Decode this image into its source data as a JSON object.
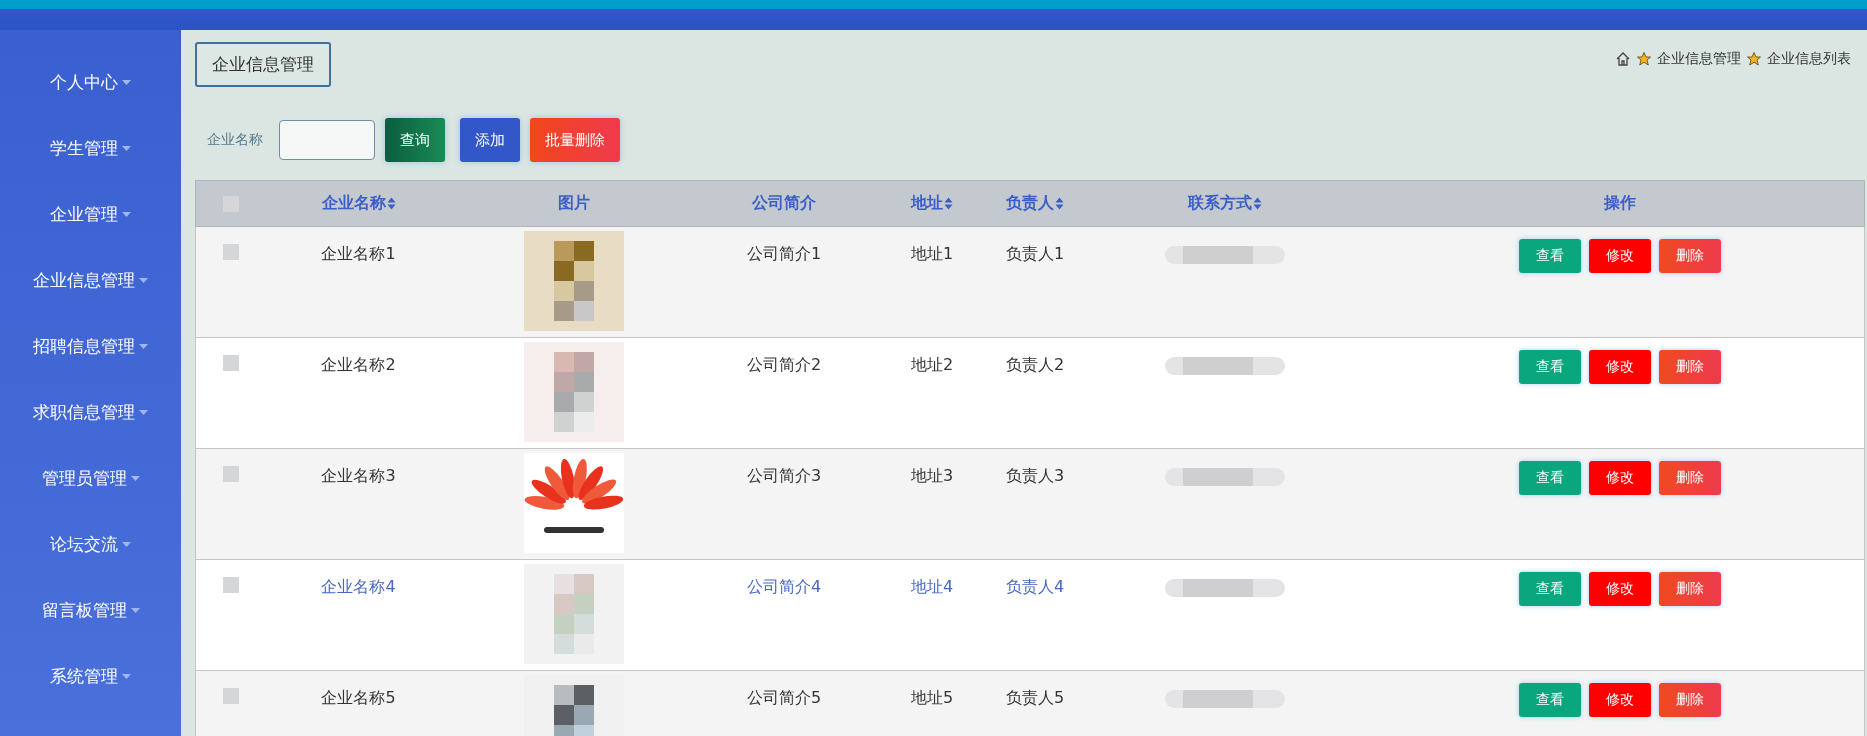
{
  "sidebar": {
    "items": [
      {
        "label": "个人中心"
      },
      {
        "label": "学生管理"
      },
      {
        "label": "企业管理"
      },
      {
        "label": "企业信息管理"
      },
      {
        "label": "招聘信息管理"
      },
      {
        "label": "求职信息管理"
      },
      {
        "label": "管理员管理"
      },
      {
        "label": "论坛交流"
      },
      {
        "label": "留言板管理"
      },
      {
        "label": "系统管理"
      }
    ]
  },
  "page_title": "企业信息管理",
  "breadcrumb": [
    "企业信息管理",
    "企业信息列表"
  ],
  "search": {
    "label": "企业名称"
  },
  "toolbar_buttons": [
    {
      "label": "查询",
      "kind": "search"
    },
    {
      "label": "添加",
      "kind": "add"
    },
    {
      "label": "批量删除",
      "kind": "batch-delete"
    }
  ],
  "table": {
    "header_checked": false,
    "columns": [
      {
        "label": "企业名称",
        "sortable": true
      },
      {
        "label": "图片",
        "sortable": false
      },
      {
        "label": "公司简介",
        "sortable": false
      },
      {
        "label": "地址",
        "sortable": true
      },
      {
        "label": "负责人",
        "sortable": true
      },
      {
        "label": "联系方式",
        "sortable": true
      },
      {
        "label": "操作",
        "sortable": false
      }
    ],
    "rows": [
      {
        "checked": false,
        "hovered": false,
        "name": "企业名称1",
        "intro": "公司简介1",
        "address": "地址1",
        "person": "负责人1",
        "actions": [
          {
            "label": "查看",
            "kind": "view"
          },
          {
            "label": "修改",
            "kind": "edit"
          },
          {
            "label": "删除",
            "kind": "delete"
          }
        ]
      },
      {
        "checked": false,
        "hovered": false,
        "name": "企业名称2",
        "intro": "公司简介2",
        "address": "地址2",
        "person": "负责人2",
        "actions": [
          {
            "label": "查看",
            "kind": "view"
          },
          {
            "label": "修改",
            "kind": "edit"
          },
          {
            "label": "删除",
            "kind": "delete"
          }
        ]
      },
      {
        "checked": false,
        "hovered": false,
        "name": "企业名称3",
        "intro": "公司简介3",
        "address": "地址3",
        "person": "负责人3",
        "actions": [
          {
            "label": "查看",
            "kind": "view"
          },
          {
            "label": "修改",
            "kind": "edit"
          },
          {
            "label": "删除",
            "kind": "delete"
          }
        ]
      },
      {
        "checked": false,
        "hovered": true,
        "name": "企业名称4",
        "intro": "公司简介4",
        "address": "地址4",
        "person": "负责人4",
        "actions": [
          {
            "label": "查看",
            "kind": "view"
          },
          {
            "label": "修改",
            "kind": "edit"
          },
          {
            "label": "删除",
            "kind": "delete"
          }
        ]
      },
      {
        "checked": false,
        "hovered": false,
        "name": "企业名称5",
        "intro": "公司简介5",
        "address": "地址5",
        "person": "负责人5",
        "actions": [
          {
            "label": "查看",
            "kind": "view"
          },
          {
            "label": "修改",
            "kind": "edit"
          },
          {
            "label": "删除",
            "kind": "delete"
          }
        ]
      }
    ]
  }
}
